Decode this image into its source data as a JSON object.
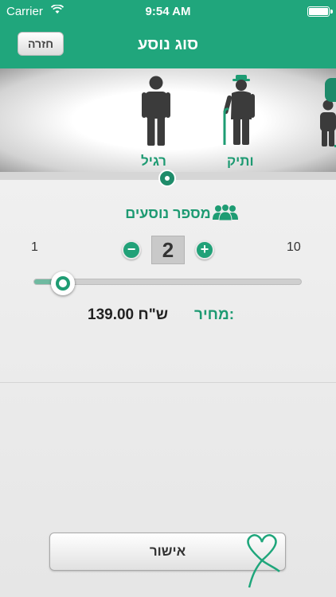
{
  "status_bar": {
    "carrier": "Carrier",
    "time": "9:54 AM"
  },
  "nav": {
    "back_label": "חזרה",
    "title": "סוג נוסע"
  },
  "passenger_types": [
    {
      "label": "רגיל",
      "icon": "adult-person-icon",
      "selected": true
    },
    {
      "label": "ותיק",
      "icon": "senior-person-icon",
      "selected": false
    },
    {
      "label": "",
      "icon": "child-person-icon",
      "selected": false
    }
  ],
  "passengers": {
    "title": "מספר נוסעים",
    "icon": "people-icon",
    "min": "1",
    "max": "10",
    "count": "2",
    "slider_fraction": 0.11
  },
  "price": {
    "label": "מחיר:",
    "value": "139.00 ש\"ח"
  },
  "confirm": {
    "label": "אישור",
    "icon": "heart-icon"
  },
  "colors": {
    "brand": "#20a67c",
    "accent_text": "#1d9a72"
  }
}
